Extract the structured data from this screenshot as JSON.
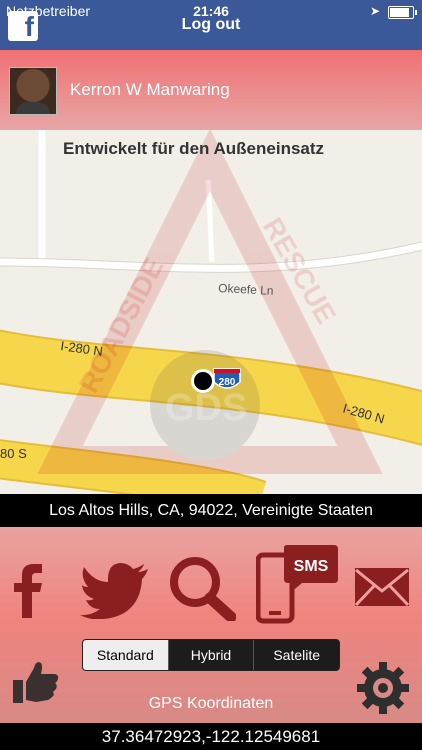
{
  "status_bar": {
    "carrier": "Netzbetreiber",
    "time": "21:46"
  },
  "header": {
    "logout_label": "Log out",
    "facebook_logo": "f"
  },
  "user": {
    "name": "Kerron W Manwaring"
  },
  "headline": "Entwickelt für den Außeneinsatz",
  "map": {
    "street_label": "Okeefe Ln",
    "highway_label_1": "I-280 N",
    "highway_label_2": "I-280 N",
    "highway_label_3": "80 S",
    "shield_number": "280",
    "shield_number_2": "280",
    "watermark_left": "ROADSIDE",
    "watermark_right": "RESCUE",
    "watermark_center": "GDS"
  },
  "address": "Los Altos Hills, CA, 94022, Vereinigte Staaten",
  "share_icons": [
    "facebook-icon",
    "twitter-icon",
    "search-icon",
    "sms-phone-icon",
    "mail-icon"
  ],
  "sms_label": "SMS",
  "map_type": {
    "options": [
      "Standard",
      "Hybrid",
      "Satelite"
    ],
    "selected": "Standard"
  },
  "gps": {
    "label": "GPS Koordinaten",
    "coordinates": "37.36472923,-122.12549681"
  },
  "colors": {
    "facebook": "#3b5998",
    "accent": "#f07072",
    "icon": "#8b1f1f"
  }
}
